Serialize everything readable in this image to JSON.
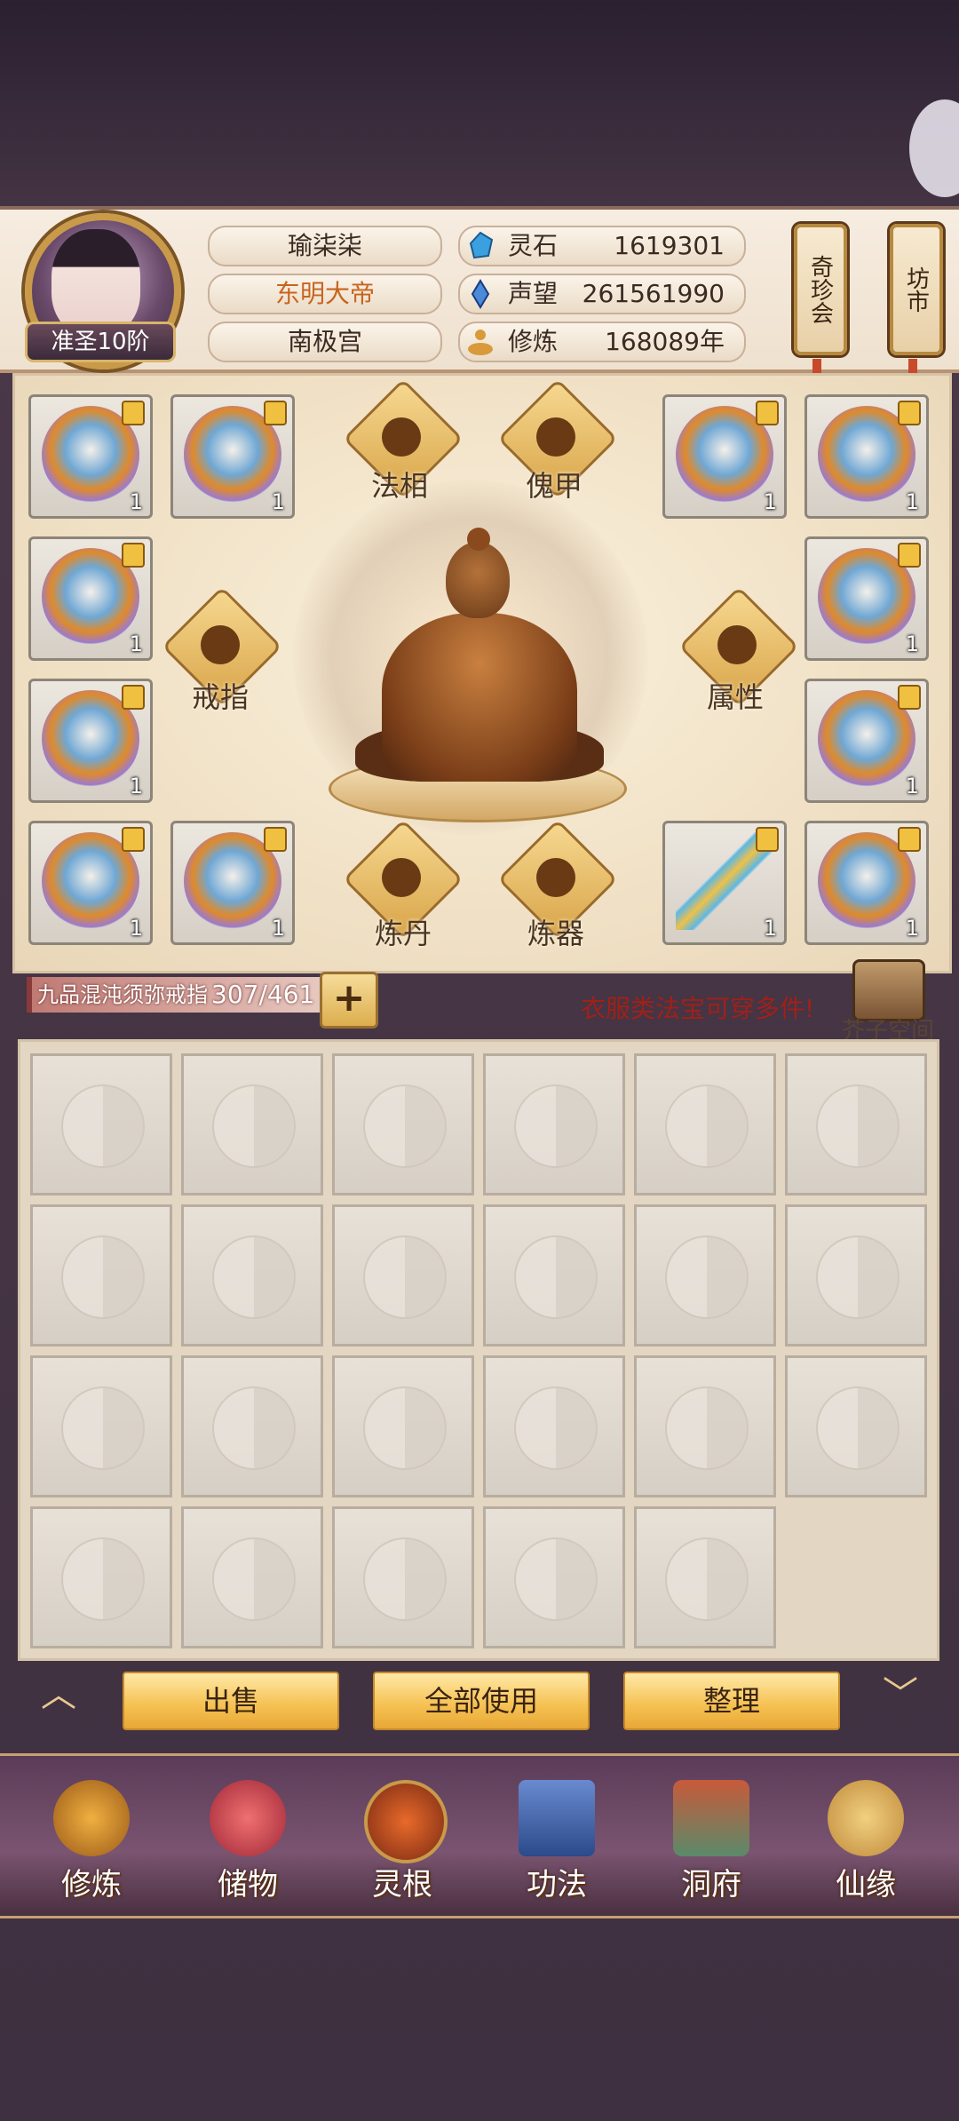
{
  "player": {
    "rank": "准圣10阶",
    "name": "瑜柒柒",
    "title": "东明大帝",
    "sect": "南极宫"
  },
  "resources": [
    {
      "icon": "spirit-stone-icon",
      "label": "灵石",
      "value": "1619301",
      "color": "#3aa0e0"
    },
    {
      "icon": "prestige-icon",
      "label": "声望",
      "value": "261561990",
      "color": "#4a8ad8"
    },
    {
      "icon": "cultivation-icon",
      "label": "修炼",
      "value": "168089年",
      "color": "#d89a3a"
    }
  ],
  "side_buttons": [
    {
      "label": "奇珍会",
      "icon": "scroll-icon"
    },
    {
      "label": "坊市",
      "icon": "scroll-icon"
    }
  ],
  "equipment": {
    "slot_count_label": "1",
    "categories": {
      "fa_xiang": "法相",
      "kui_jia": "傀甲",
      "jie_zhi": "戒指",
      "shu_xing": "属性",
      "lian_dan": "炼丹",
      "lian_qi": "炼器"
    }
  },
  "ring": {
    "name": "九品混沌须弥戒指",
    "capacity": "307/461",
    "add_label": "+"
  },
  "hint": "衣服类法宝可穿多件!",
  "storage_label": "芥子空间",
  "actions": {
    "sell": "出售",
    "use_all": "全部使用",
    "sort": "整理"
  },
  "nav": [
    {
      "label": "修炼",
      "icon": "cultivate-monk-icon"
    },
    {
      "label": "储物",
      "icon": "storage-pouch-icon"
    },
    {
      "label": "灵根",
      "icon": "spirit-root-icon"
    },
    {
      "label": "功法",
      "icon": "technique-book-icon"
    },
    {
      "label": "洞府",
      "icon": "cave-dwelling-icon"
    },
    {
      "label": "仙缘",
      "icon": "immortal-fate-icon"
    }
  ],
  "colors": {
    "accent_gold": "#f5c050",
    "title_orange": "#c8641e",
    "hint_red": "#a02018"
  }
}
